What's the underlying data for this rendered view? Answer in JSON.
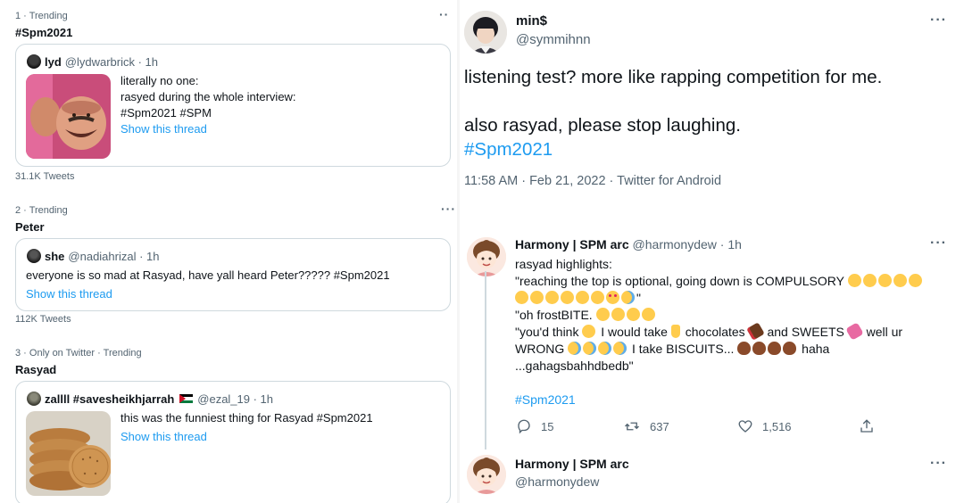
{
  "trending": [
    {
      "meta": "1 · Trending",
      "name": "#Spm2021",
      "card": {
        "author_name": "lyd",
        "author_handle": "@lydwarbrick · 1h",
        "lines": [
          "literally no one:",
          "rasyed during the whole interview:",
          "#Spm2021 #SPM"
        ],
        "link": "Show this thread"
      },
      "count": "31.1K Tweets"
    },
    {
      "meta": "2 · Trending",
      "name": "Peter",
      "card": {
        "author_name": "she",
        "author_handle": "@nadiahrizal · 1h",
        "lines": [
          "everyone is so mad at Rasyad, have yall heard Peter????? #Spm2021"
        ],
        "link": "Show this thread"
      },
      "count": "112K Tweets"
    },
    {
      "meta": "3 · Only on Twitter · Trending",
      "name": "Rasyad",
      "card": {
        "author_name": "zallll #savesheikhjarrah",
        "author_handle": "@ezal_19 · 1h",
        "lines": [
          "this was the funniest thing for Rasyad #Spm2021"
        ],
        "link": "Show this thread"
      }
    }
  ],
  "main_tweet": {
    "name": "min$",
    "handle": "@symmihnn",
    "line1": "listening test? more like rapping competition for me.",
    "line2": "also rasyad, please stop laughing.",
    "hashtag": "#Spm2021",
    "timestamp": "11:58 AM · Feb 21, 2022 · Twitter for Android"
  },
  "reply": {
    "name": "Harmony | SPM arc",
    "handle": "@harmonydew · 1h",
    "lines": {
      "l1": "rasyad highlights:",
      "l2": "\"reaching the top is optional, going down is COMPULSORY",
      "l3_end": "\"",
      "l4": "\"oh frostBITE.",
      "l5a": "\"you'd think",
      "l5b": "I would take",
      "l5c": "chocolates",
      "l5d": "and SWEETS",
      "l5e": "well ur",
      "l6a": "WRONG",
      "l6b": "I take BISCUITS...",
      "l6c": "haha",
      "l7": "...gahagsbahhdbedb\"",
      "hashtag": "#Spm2021"
    },
    "actions": {
      "replies": "15",
      "retweets": "637",
      "likes": "1,516"
    }
  },
  "reply2": {
    "name": "Harmony | SPM arc",
    "handle": "@harmonydew"
  },
  "colors": {
    "link": "#1d9bf0",
    "muted": "#536471",
    "border": "#cfd9de"
  }
}
